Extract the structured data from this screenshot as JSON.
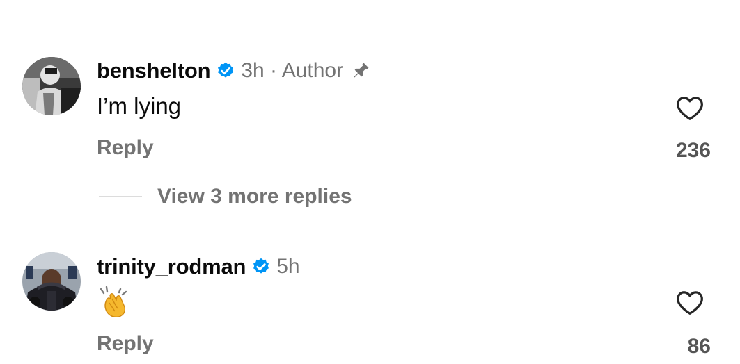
{
  "comments": [
    {
      "username": "benshelton",
      "verified": true,
      "meta": "3h · Author",
      "pinned": true,
      "text": "I’m lying",
      "reply_label": "Reply",
      "likes": "236",
      "avatar_icon": "grayscale-photo-avatar"
    },
    {
      "username": "trinity_rodman",
      "verified": true,
      "meta": "5h",
      "pinned": false,
      "text": "👏",
      "reply_label": "Reply",
      "likes": "86",
      "avatar_icon": "race-car-photo-avatar"
    }
  ],
  "view_replies": {
    "label": "View 3 more replies"
  },
  "icons": {
    "verified": "verified-badge-icon",
    "pin": "pin-icon",
    "like": "heart-outline-icon",
    "reaction": "clapping-hands-emoji"
  },
  "colors": {
    "verified_blue": "#0095f6",
    "muted_text": "#737373",
    "primary_text": "#0a0a0a"
  }
}
